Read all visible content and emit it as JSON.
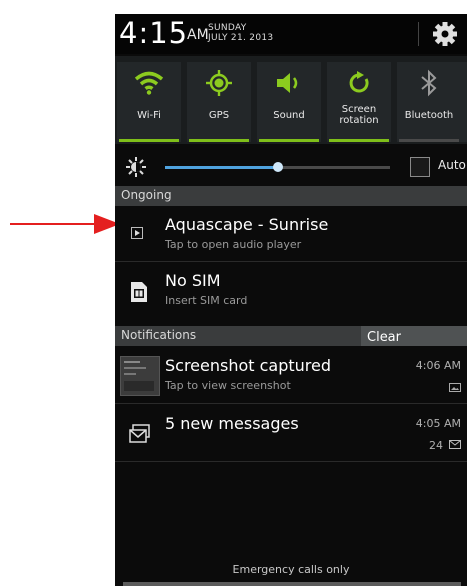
{
  "status": {
    "time": "4:15",
    "ampm": "AM",
    "day": "SUNDAY",
    "date": "JULY 21. 2013"
  },
  "toggles": [
    {
      "label": "Wi-Fi",
      "icon": "wifi-icon",
      "on": true
    },
    {
      "label": "GPS",
      "icon": "gps-icon",
      "on": true
    },
    {
      "label": "Sound",
      "icon": "sound-icon",
      "on": true
    },
    {
      "label": "Screen\nrotation",
      "icon": "rotation-icon",
      "on": true
    },
    {
      "label": "Bluetooth",
      "icon": "bluetooth-icon",
      "on": false
    }
  ],
  "brightness": {
    "level": 0.5,
    "auto_label": "Auto"
  },
  "ongoing": {
    "header": "Ongoing",
    "items": [
      {
        "title": "Aquascape - Sunrise",
        "subtitle": "Tap to open audio player",
        "icon": "play-icon"
      },
      {
        "title": "No SIM",
        "subtitle": "Insert SIM card",
        "icon": "sim-card-icon"
      }
    ]
  },
  "notifications": {
    "header": "Notifications",
    "clear_label": "Clear",
    "items": [
      {
        "title": "Screenshot captured",
        "subtitle": "Tap to view screenshot",
        "time": "4:06 AM",
        "icon": "screenshot-thumbnail"
      },
      {
        "title": "5 new messages",
        "subtitle": "",
        "time": "4:05 AM",
        "count": "24",
        "icon": "email-icon"
      }
    ]
  },
  "footer": {
    "text": "Emergency calls only"
  },
  "colors": {
    "accent_green": "#7fbf1a",
    "slider_blue": "#4fa3df",
    "arrow_red": "#e41f1f"
  }
}
